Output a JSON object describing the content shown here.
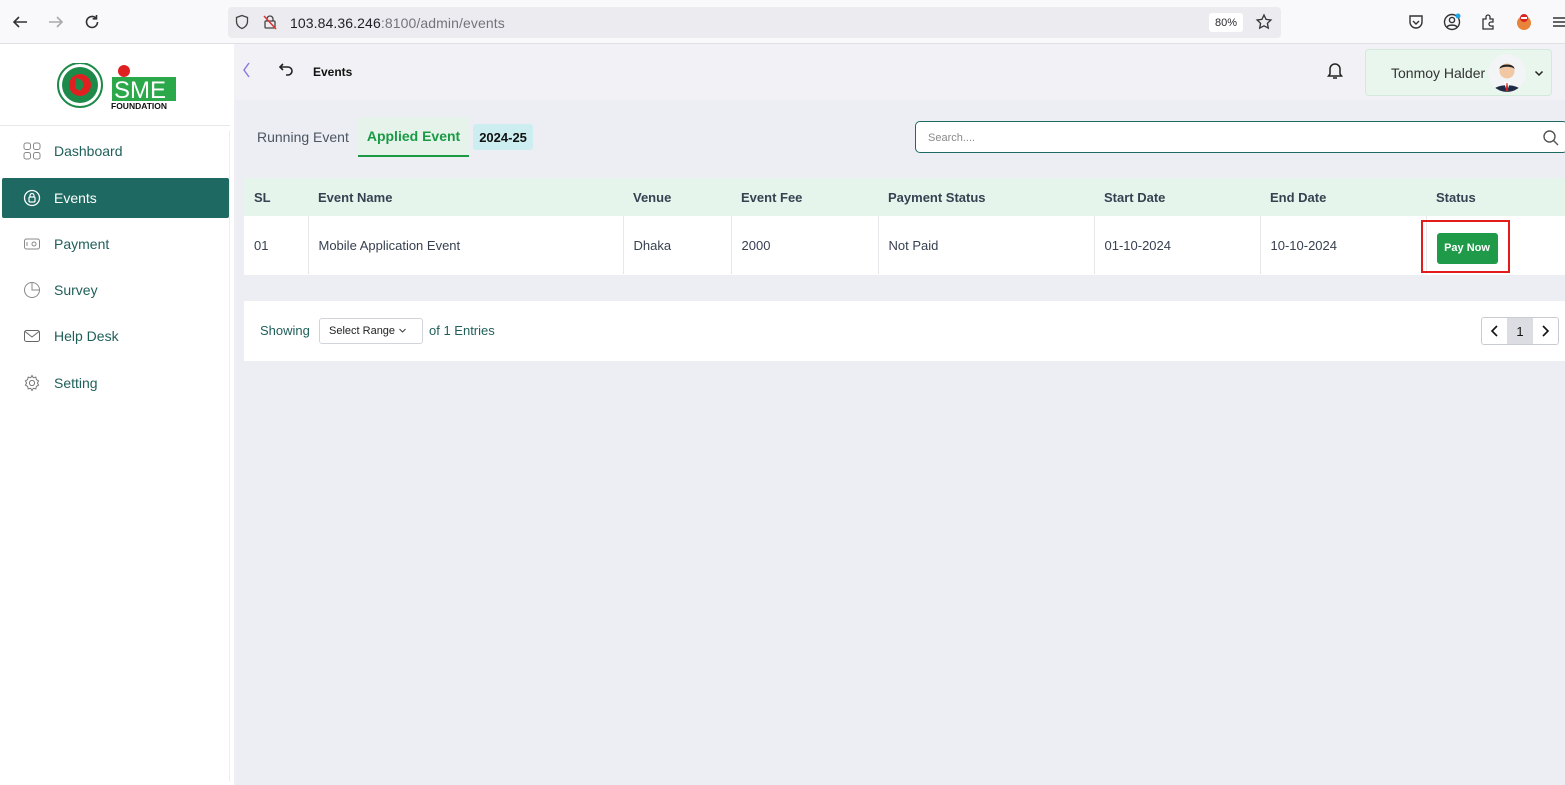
{
  "browser": {
    "url_host": "103.84.36.246",
    "url_rest": ":8100/admin/events",
    "zoom": "80%"
  },
  "header": {
    "page_title": "Events",
    "user_name": "Tonmoy Halder"
  },
  "logo": {
    "brand": "SME",
    "sub": "FOUNDATION"
  },
  "sidebar": {
    "items": [
      {
        "label": "Dashboard",
        "icon": "grid-icon"
      },
      {
        "label": "Events",
        "icon": "lock-circle-icon",
        "active": true
      },
      {
        "label": "Payment",
        "icon": "card-icon"
      },
      {
        "label": "Survey",
        "icon": "pie-icon"
      },
      {
        "label": "Help Desk",
        "icon": "mail-icon"
      },
      {
        "label": "Setting",
        "icon": "gear-icon"
      }
    ]
  },
  "tabs": {
    "running": "Running Event",
    "applied": "Applied Event",
    "year": "2024-25"
  },
  "search": {
    "placeholder": "Search...."
  },
  "table": {
    "columns": [
      "SL",
      "Event Name",
      "Venue",
      "Event Fee",
      "Payment Status",
      "Start Date",
      "End Date",
      "Status"
    ],
    "rows": [
      {
        "sl": "01",
        "event_name": "Mobile Application Event",
        "venue": "Dhaka",
        "fee": "2000",
        "payment_status": "Not Paid",
        "start": "01-10-2024",
        "end": "10-10-2024",
        "action": "Pay Now"
      }
    ]
  },
  "footer": {
    "showing": "Showing",
    "range": "Select Range",
    "entries": "of 1 Entries",
    "page": "1"
  },
  "colors": {
    "primary": "#1e6961",
    "accent_green": "#1a9a45",
    "highlight_red": "#e21b1b"
  }
}
